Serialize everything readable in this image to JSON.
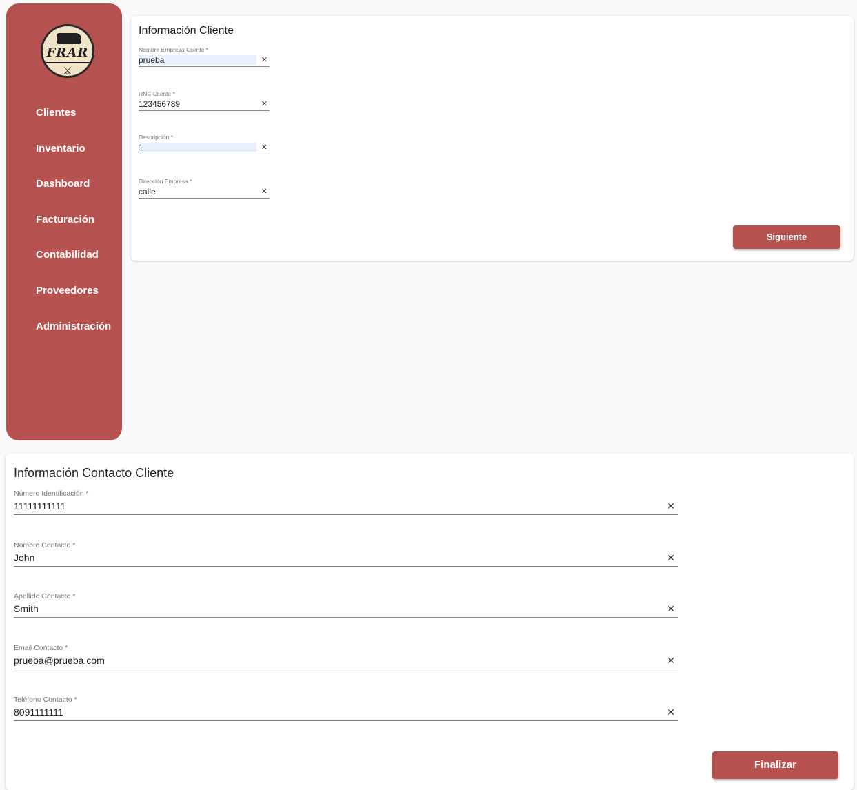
{
  "sidebar": {
    "logo_text": "FRAR",
    "items": [
      {
        "label": "Clientes"
      },
      {
        "label": "Inventario"
      },
      {
        "label": "Dashboard"
      },
      {
        "label": "Facturación"
      },
      {
        "label": "Contabilidad"
      },
      {
        "label": "Proveedores"
      },
      {
        "label": "Administración"
      }
    ]
  },
  "client_info": {
    "title": "Información Cliente",
    "fields": [
      {
        "label": "Nombre Empresa Cliente *",
        "value": "prueba"
      },
      {
        "label": "RNC Cliente *",
        "value": "123456789"
      },
      {
        "label": "Descripción *",
        "value": "1"
      },
      {
        "label": "Dirección Empresa *",
        "value": "calle"
      }
    ],
    "next_label": "Siguiente"
  },
  "contact_info": {
    "title": "Información Contacto Cliente",
    "fields": [
      {
        "label": "Número Identificación *",
        "value": "11111111111"
      },
      {
        "label": "Nombre Contacto *",
        "value": "John"
      },
      {
        "label": "Apellido Contacto *",
        "value": "Smith"
      },
      {
        "label": "Email Contacto *",
        "value": "prueba@prueba.com"
      },
      {
        "label": "Teléfono Contacto *",
        "value": "8091111111"
      }
    ],
    "finish_label": "Finalizar"
  },
  "icons": {
    "clear": "close-icon"
  },
  "colors": {
    "accent": "#b5514e",
    "autofill": "#e8f0fe"
  }
}
